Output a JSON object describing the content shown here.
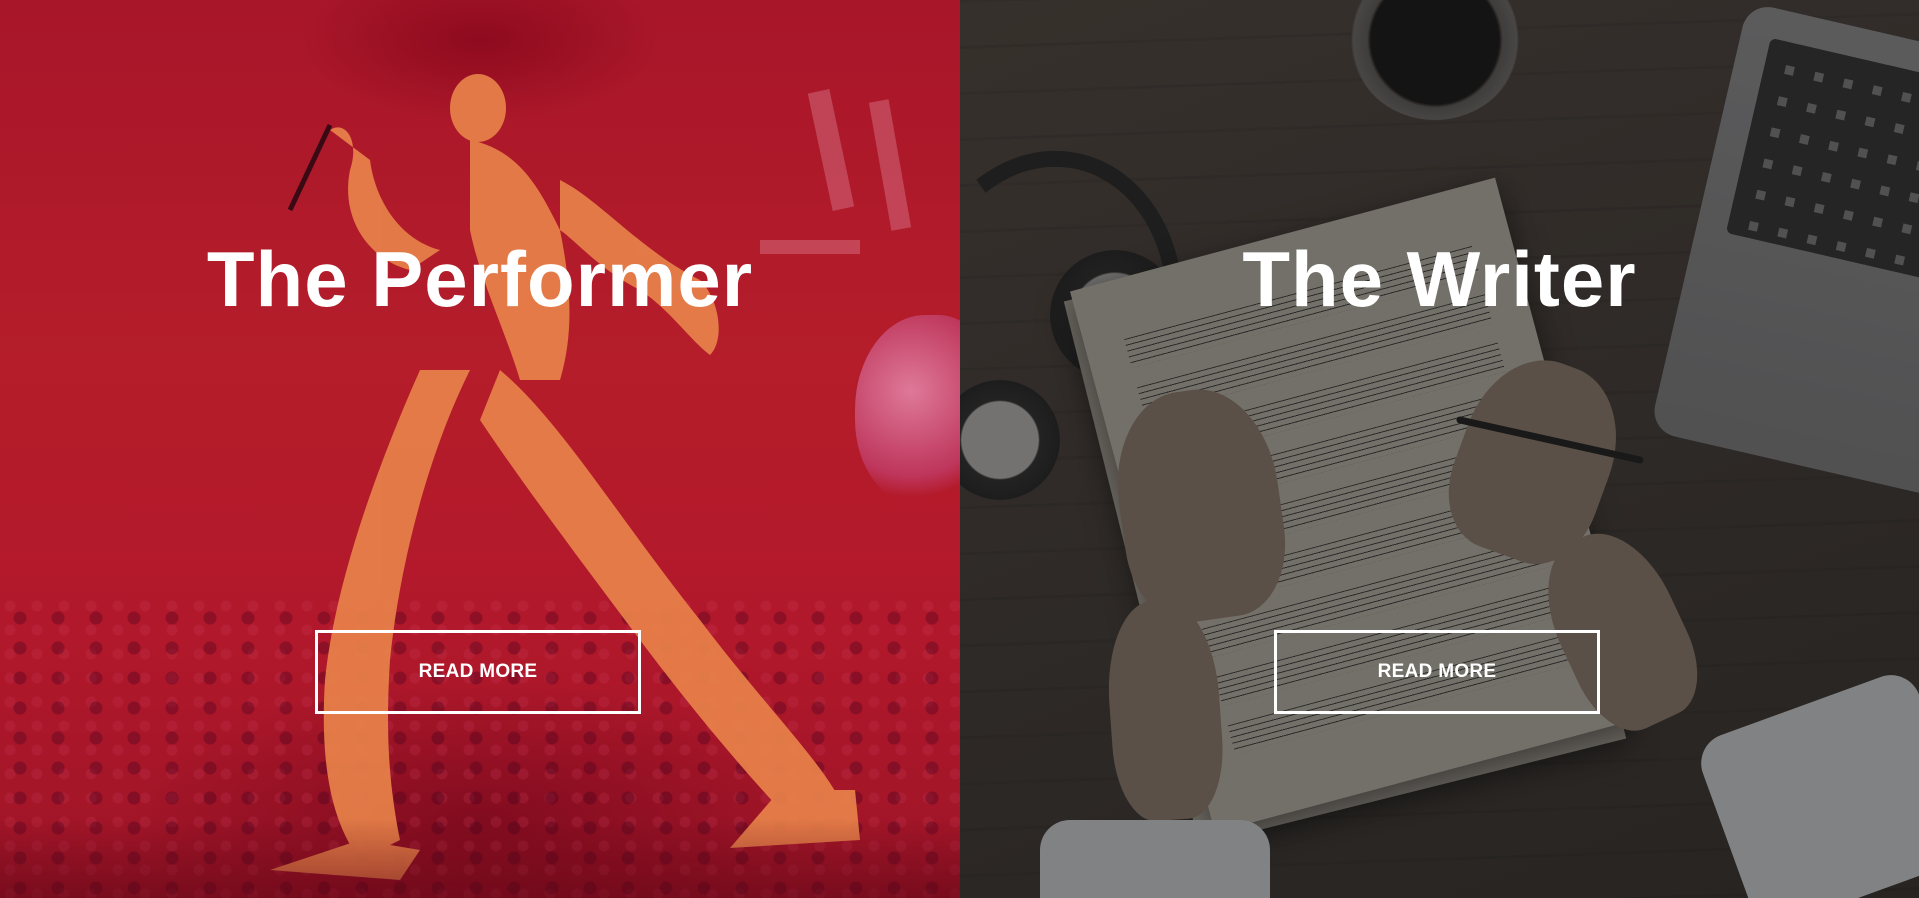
{
  "panels": [
    {
      "title": "The Performer",
      "button_label": "READ MORE",
      "overlay_color": "#b11e26",
      "background_image": "performer-on-stage-image"
    },
    {
      "title": "The Writer",
      "button_label": "READ MORE",
      "overlay_color": "#3a332e",
      "background_image": "sheet-music-writing-desk-image"
    }
  ]
}
